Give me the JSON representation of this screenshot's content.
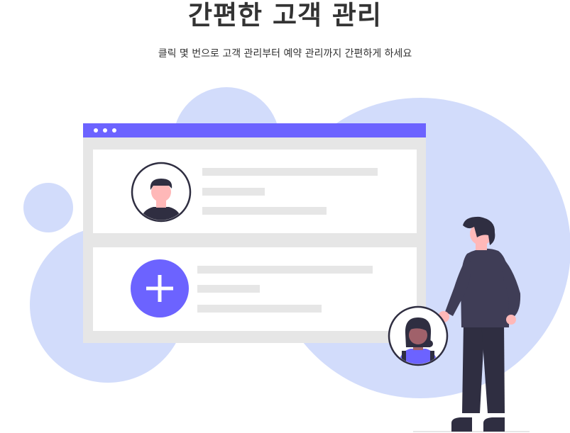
{
  "hero": {
    "title": "간편한 고객 관리",
    "subtitle": "클릭 몇 번으로 고객 관리부터 예약 관리까지 간편하게 하세요"
  },
  "colors": {
    "accent": "#6C63FF",
    "blob": "#D2DCFB",
    "panel": "#E6E6E6",
    "dark": "#2F2E41",
    "skin": "#FFB8B8",
    "text": "#333333"
  },
  "illustration": {
    "window_dots": 3,
    "cards": [
      {
        "kind": "customer-profile"
      },
      {
        "kind": "add-customer"
      }
    ]
  }
}
